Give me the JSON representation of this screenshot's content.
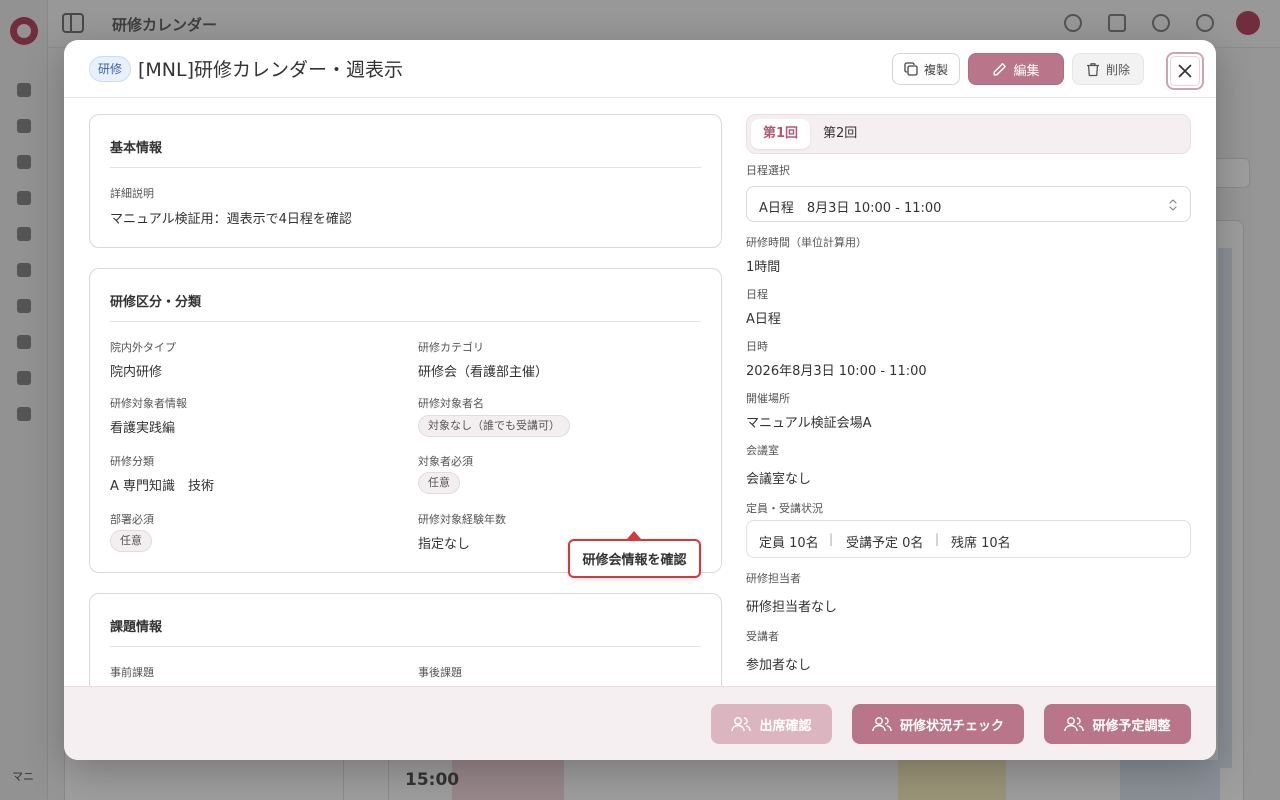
{
  "background": {
    "app_title": "研修カレンダー",
    "footer_text": "マニ",
    "calendar_time": "15:00"
  },
  "modal": {
    "tag": "研修",
    "title": "[MNL]研修カレンダー・週表示",
    "actions": {
      "copy": "複製",
      "edit": "編集",
      "delete": "削除"
    },
    "basic_info": {
      "heading": "基本情報",
      "description_label": "詳細説明",
      "description_value": "マニュアル検証用：週表示で4日程を確認"
    },
    "classification": {
      "heading": "研修区分・分類",
      "inout_label": "院内外タイプ",
      "inout_value": "院内研修",
      "category_label": "研修カテゴリ",
      "category_value": "研修会（看護部主催）",
      "target_info_label": "研修対象者情報",
      "target_info_value": "看護実践編",
      "target_name_label": "研修対象者名",
      "target_name_value": "対象なし（誰でも受講可）",
      "division_label": "研修分類",
      "division_value": "A  専門知識　技術",
      "target_required_label": "対象者必須",
      "target_required_value": "任意",
      "dept_required_label": "部署必須",
      "dept_required_value": "任意",
      "years_label": "研修対象経験年数",
      "years_value": "指定なし"
    },
    "tasks": {
      "heading": "課題情報",
      "pre_label": "事前課題",
      "post_label": "事後課題"
    },
    "callout": "研修会情報を確認",
    "session": {
      "tabs": [
        "第1回",
        "第2回"
      ],
      "schedule_select_label": "日程選択",
      "schedule_select_value": "A日程　8月3日 10:00 - 11:00",
      "hours_label": "研修時間（単位計算用）",
      "hours_value": "1時間",
      "schedule_label": "日程",
      "schedule_value": "A日程",
      "datetime_label": "日時",
      "datetime_value": "2026年8月3日 10:00 - 11:00",
      "venue_label": "開催場所",
      "venue_value": "マニュアル検証会場A",
      "room_label": "会議室",
      "room_value": "会議室なし",
      "capacity_label": "定員・受講状況",
      "capacity_total": "定員 10名",
      "capacity_planned": "受講予定 0名",
      "capacity_remaining": "残席 10名",
      "separator": "|",
      "staff_label": "研修担当者",
      "staff_value": "研修担当者なし",
      "attendees_label": "受講者",
      "attendees_value": "参加者なし"
    },
    "footer": {
      "attendance": "出席確認",
      "status_check": "研修状況チェック",
      "schedule_adjust": "研修予定調整"
    }
  },
  "colors": {
    "accent": "#b9768a",
    "accent_disabled": "#dbb6c1",
    "callout_border": "#d23b3b",
    "tab_active_text": "#b05a74"
  }
}
